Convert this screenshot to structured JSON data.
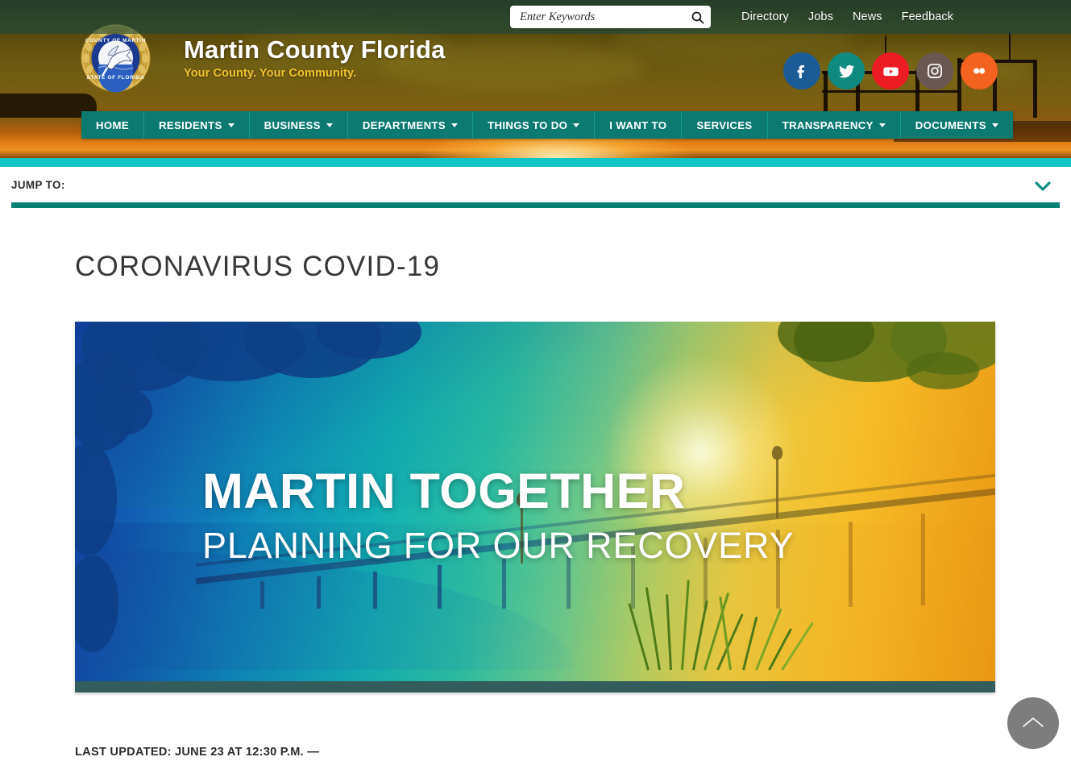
{
  "site": {
    "title": "Martin County Florida",
    "tagline": "Your County. Your Community.",
    "seal_top_text": "COUNTY OF MARTIN",
    "seal_bottom_text": "STATE OF FLORIDA"
  },
  "search": {
    "placeholder": "Enter Keywords",
    "value": "",
    "icon": "search-icon"
  },
  "utility_links": [
    {
      "label": "Directory"
    },
    {
      "label": "Jobs"
    },
    {
      "label": "News"
    },
    {
      "label": "Feedback"
    }
  ],
  "social": [
    {
      "name": "facebook",
      "glyph": "f",
      "color": "#1b5c96"
    },
    {
      "name": "twitter",
      "glyph": "t",
      "color": "#0f8a80"
    },
    {
      "name": "youtube",
      "glyph": "y",
      "color": "#ec1c24"
    },
    {
      "name": "instagram",
      "glyph": "i",
      "color": "#6b5752"
    },
    {
      "name": "flickr",
      "glyph": "fl",
      "color": "#f4621f"
    }
  ],
  "nav": [
    {
      "label": "HOME",
      "has_dropdown": false
    },
    {
      "label": "RESIDENTS",
      "has_dropdown": true
    },
    {
      "label": "BUSINESS",
      "has_dropdown": true
    },
    {
      "label": "DEPARTMENTS",
      "has_dropdown": true
    },
    {
      "label": "THINGS TO DO",
      "has_dropdown": true
    },
    {
      "label": "I WANT TO",
      "has_dropdown": false
    },
    {
      "label": "SERVICES",
      "has_dropdown": false
    },
    {
      "label": "TRANSPARENCY",
      "has_dropdown": true
    },
    {
      "label": "DOCUMENTS",
      "has_dropdown": true
    }
  ],
  "jump_to": {
    "label": "JUMP TO:",
    "chevron_icon": "chevron-down-icon"
  },
  "main": {
    "page_title": "CORONAVIRUS COVID-19",
    "hero": {
      "headline": "MARTIN TOGETHER",
      "subhead": "PLANNING FOR OUR RECOVERY",
      "alt": "Martin Together - Planning for our Recovery banner"
    },
    "last_updated": "LAST UPDATED: JUNE 23 AT 12:30 P.M. —"
  },
  "back_to_top": {
    "icon": "chevron-up-icon",
    "label": "Back to top"
  },
  "colors": {
    "nav_teal": "#0d7a72",
    "band_turquoise": "#12c6c6",
    "rule_teal": "#0a8077",
    "tagline_gold": "#f2c230",
    "back_to_top_gray": "#7d7d7d"
  }
}
